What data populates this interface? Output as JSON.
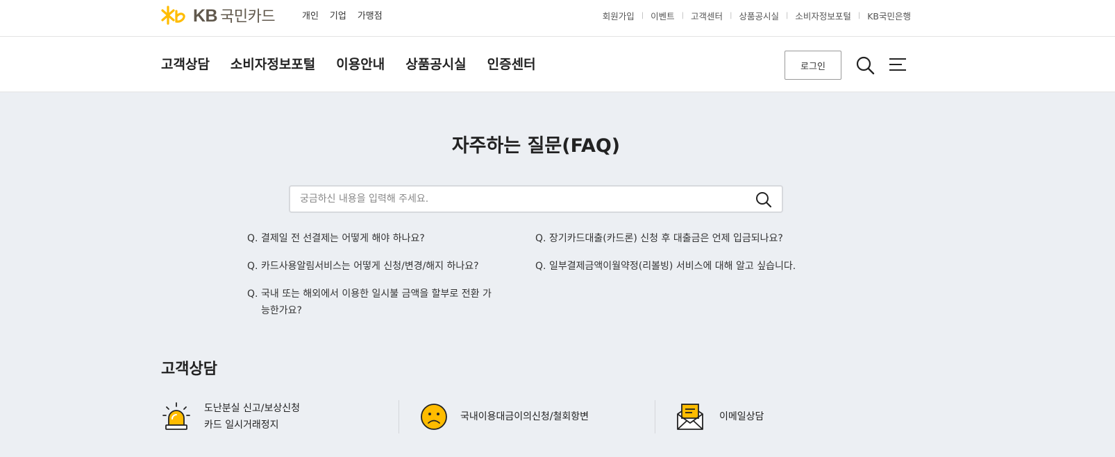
{
  "logo": {
    "brand": "KB",
    "name": "국민카드"
  },
  "segment_nav": [
    "개인",
    "기업",
    "가맹점"
  ],
  "util_nav": [
    "회원가입",
    "이벤트",
    "고객센터",
    "상품공시실",
    "소비자정보포털",
    "KB국민은행"
  ],
  "util_separator": "|",
  "gnb": {
    "menu": [
      "고객상담",
      "소비자정보포털",
      "이용안내",
      "상품공시실",
      "인증센터"
    ],
    "login_label": "로그인"
  },
  "faq": {
    "title": "자주하는 질문(FAQ)",
    "search_placeholder": "궁금하신 내용을 입력해 주세요.",
    "q_prefix": "Q.",
    "items": [
      "결제일 전 선결제는 어떻게 해야 하나요?",
      "장기카드대출(카드론) 신청 후 대출금은 언제 입금되나요?",
      "카드사용알림서비스는 어떻게 신청/변경/해지 하나요?",
      "일부결제금액이월약정(리볼빙) 서비스에 대해 알고 싶습니다.",
      "국내 또는 해외에서 이용한 일시불 금액을 할부로 전환 가능한가요?"
    ]
  },
  "consult": {
    "title": "고객상담",
    "services": [
      {
        "line1": "도난분실 신고/보상신청",
        "line2": "카드 일시거래정지",
        "icon": "siren-icon"
      },
      {
        "line1": "국내이용대금이의신청/철회항변",
        "icon": "frown-face-icon"
      },
      {
        "line1": "이메일상담",
        "icon": "email-icon"
      }
    ]
  },
  "colors": {
    "accent": "#ffbc00",
    "brand_text": "#60584c",
    "background": "#eceff3"
  }
}
